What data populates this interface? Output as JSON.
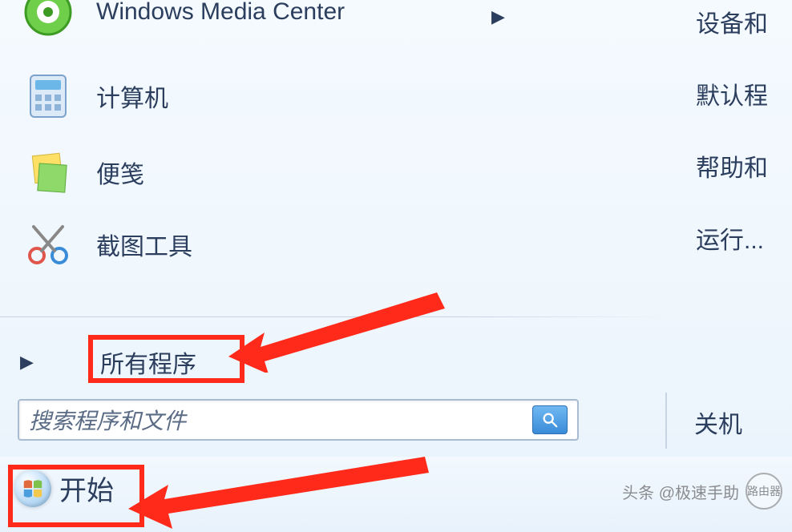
{
  "programs": {
    "wmc": "Windows Media Center",
    "computer": "计算机",
    "notes": "便笺",
    "snip": "截图工具"
  },
  "all_programs_label": "所有程序",
  "search_placeholder": "搜索程序和文件",
  "right_links": {
    "devices": "设备和",
    "defaults": "默认程",
    "help": "帮助和",
    "run": "运行..."
  },
  "shutdown_label": "关机",
  "start_label": "开始",
  "watermark_prefix": "头条 @极速手助",
  "watermark_badge": "路由器",
  "icons": {
    "wmc": "media-center-icon",
    "computer": "calculator-icon",
    "notes": "sticky-notes-icon",
    "snip": "scissors-icon",
    "start_orb": "windows-logo-icon",
    "search": "search-icon",
    "chevron_right": "chevron-right-icon"
  },
  "colors": {
    "highlight_red": "#ff2a1a",
    "text": "#2c3e5e",
    "accent_blue": "#3a8cd8"
  }
}
